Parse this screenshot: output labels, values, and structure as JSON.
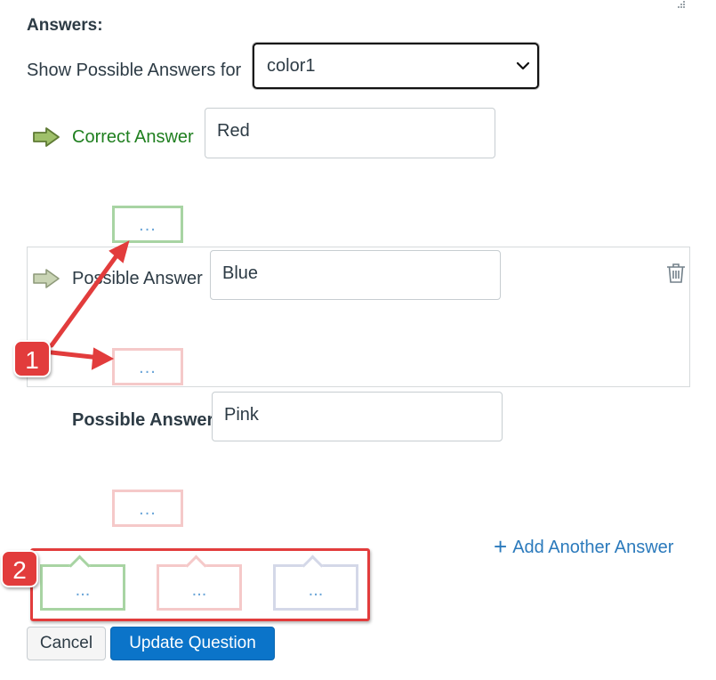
{
  "heading": "Answers:",
  "show_answers": {
    "label": "Show Possible Answers for",
    "selected": "color1"
  },
  "correct_answer": {
    "label": "Correct Answer",
    "value": "Red",
    "feedback": "..."
  },
  "possible_answers": [
    {
      "label": "Possible Answer",
      "value": "Blue",
      "feedback": "..."
    },
    {
      "label": "Possible Answer",
      "value": "Pink",
      "feedback": "..."
    }
  ],
  "add_link": {
    "label": "Add Another Answer",
    "plus": "+"
  },
  "callouts": [
    {
      "text": "...",
      "color": "#a8d4a3"
    },
    {
      "text": "...",
      "color": "#f5c9c9"
    },
    {
      "text": "...",
      "color": "#d4d8e8"
    }
  ],
  "annotations": {
    "badge1": "1",
    "badge2": "2",
    "color": "#e23c3c"
  },
  "buttons": {
    "cancel": "Cancel",
    "update": "Update Question"
  },
  "icons": [
    "arrow-right-icon",
    "trash-icon",
    "plus-icon",
    "chevron-down-icon",
    "resize-grip-icon"
  ]
}
